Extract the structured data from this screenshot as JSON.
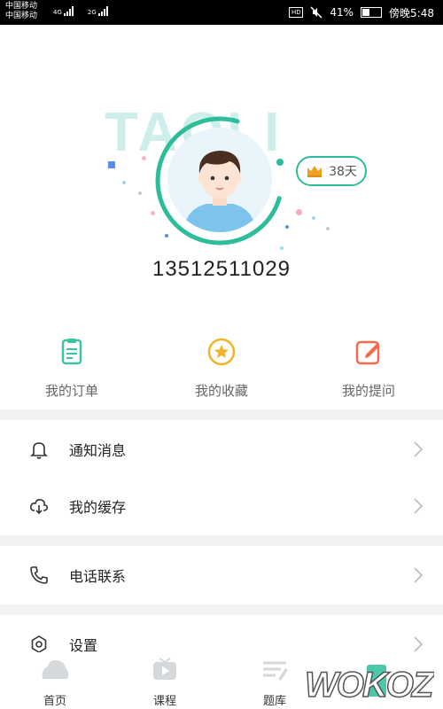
{
  "status_bar": {
    "carrier1": "中国移动",
    "carrier2": "中国移动",
    "net1": "4G",
    "net2": "2G",
    "hd": "HD",
    "battery_percent": "41%",
    "time": "傍晚5:48"
  },
  "profile": {
    "watermark": "TAOLI",
    "vip_days": "38天",
    "phone": "13512511029"
  },
  "quick_actions": [
    {
      "label": "我的订单",
      "icon": "order-icon"
    },
    {
      "label": "我的收藏",
      "icon": "favorite-star-icon"
    },
    {
      "label": "我的提问",
      "icon": "edit-question-icon"
    }
  ],
  "menu": [
    {
      "label": "通知消息",
      "icon": "bell-icon"
    },
    {
      "label": "我的缓存",
      "icon": "cloud-download-icon"
    },
    {
      "label": "电话联系",
      "icon": "phone-icon"
    },
    {
      "label": "设置",
      "icon": "settings-icon"
    }
  ],
  "tabs": [
    {
      "label": "首页",
      "icon": "home-icon"
    },
    {
      "label": "课程",
      "icon": "video-course-icon"
    },
    {
      "label": "题库",
      "icon": "question-bank-icon"
    }
  ],
  "site_logo": "WOKOZ",
  "colors": {
    "accent": "#2dbd9a",
    "order_icon": "#3cc4a4",
    "star_icon": "#f0b429",
    "question_icon": "#f26b4f",
    "divider": "#f2f2f2"
  }
}
